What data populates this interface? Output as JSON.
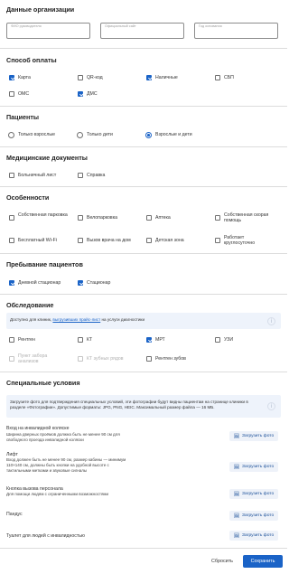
{
  "org_data": {
    "title": "Данные организации",
    "fields": [
      {
        "placeholder": "ФИО руководителя"
      },
      {
        "placeholder": "Официальный сайт"
      },
      {
        "placeholder": "Год основания"
      }
    ]
  },
  "payment": {
    "title": "Способ оплаты",
    "options": [
      {
        "label": "Карта",
        "checked": true
      },
      {
        "label": "QR-код",
        "checked": false
      },
      {
        "label": "Наличные",
        "checked": true
      },
      {
        "label": "СБП",
        "checked": false
      },
      {
        "label": "ОМС",
        "checked": false
      },
      {
        "label": "ДМС",
        "checked": true
      }
    ]
  },
  "patients": {
    "title": "Пациенты",
    "options": [
      {
        "label": "Только взрослые",
        "selected": false
      },
      {
        "label": "Только дети",
        "selected": false
      },
      {
        "label": "Взрослые и дети",
        "selected": true
      }
    ]
  },
  "documents": {
    "title": "Медицинские документы",
    "options": [
      {
        "label": "Больничный лист",
        "checked": false
      },
      {
        "label": "Справка",
        "checked": false
      }
    ]
  },
  "features": {
    "title": "Особенности",
    "options": [
      {
        "label": "Собственная парковка",
        "checked": false
      },
      {
        "label": "Велопарковка",
        "checked": false
      },
      {
        "label": "Аптека",
        "checked": false
      },
      {
        "label": "Собственная скорая помощь",
        "checked": false
      },
      {
        "label": "Бесплатный Wi-Fi",
        "checked": false
      },
      {
        "label": "Вызов врача на дом",
        "checked": false
      },
      {
        "label": "Детская зона",
        "checked": false
      },
      {
        "label": "Работает круглосуточно",
        "checked": false
      }
    ]
  },
  "stay": {
    "title": "Пребывание пациентов",
    "options": [
      {
        "label": "Дневной стационар",
        "checked": true
      },
      {
        "label": "Стационар",
        "checked": true
      }
    ]
  },
  "exam": {
    "title": "Обследование",
    "info_prefix": "Доступно для клиник, ",
    "info_link": "выгрузивших прайс-лист",
    "info_suffix": " на услуги диагностики",
    "info_icon": "i",
    "options": [
      {
        "label": "Рентген",
        "checked": false,
        "disabled": false
      },
      {
        "label": "КТ",
        "checked": false,
        "disabled": false
      },
      {
        "label": "МРТ",
        "checked": true,
        "disabled": false
      },
      {
        "label": "УЗИ",
        "checked": false,
        "disabled": false
      },
      {
        "label": "Пункт забора анализов",
        "checked": false,
        "disabled": true
      },
      {
        "label": "КТ зубных рядов",
        "checked": false,
        "disabled": true
      },
      {
        "label": "Рентген зубов",
        "checked": false,
        "disabled": false
      }
    ]
  },
  "special": {
    "title": "Специальные условия",
    "info": "Загрузите фото для подтверждения специальных условий, эти фотографии будут видны пациентам на странице клиники в разделе «Фотографии». Допустимые форматы: JPG, PNG, HEIC. Максимальный размер файла — 16 МБ.",
    "info_icon": "i",
    "upload_label": "Загрузить фото",
    "items": [
      {
        "title": "Вход на инвалидной коляске",
        "desc": "Ширина дверных проёмов должна быть не менее 90 см для свободного проезда инвалидной коляски"
      },
      {
        "title": "Лифт",
        "desc": "Вход должен быть не менее 90 см, размер кабины — минимум 110×140 см, должны быть кнопки на удобной высоте с тактильными метками и звуковые сигналы"
      },
      {
        "title": "Кнопка вызова персонала",
        "desc": "Для помощи людям с ограниченными возможностями"
      },
      {
        "title": "Пандус",
        "desc": ""
      },
      {
        "title": "Туалет для людей с инвалидностью",
        "desc": ""
      }
    ]
  },
  "footer": {
    "reset_label": "Сбросить",
    "save_label": "Сохранить"
  },
  "colors": {
    "accent": "#1a63c7",
    "info_bg": "#eef3fb"
  }
}
